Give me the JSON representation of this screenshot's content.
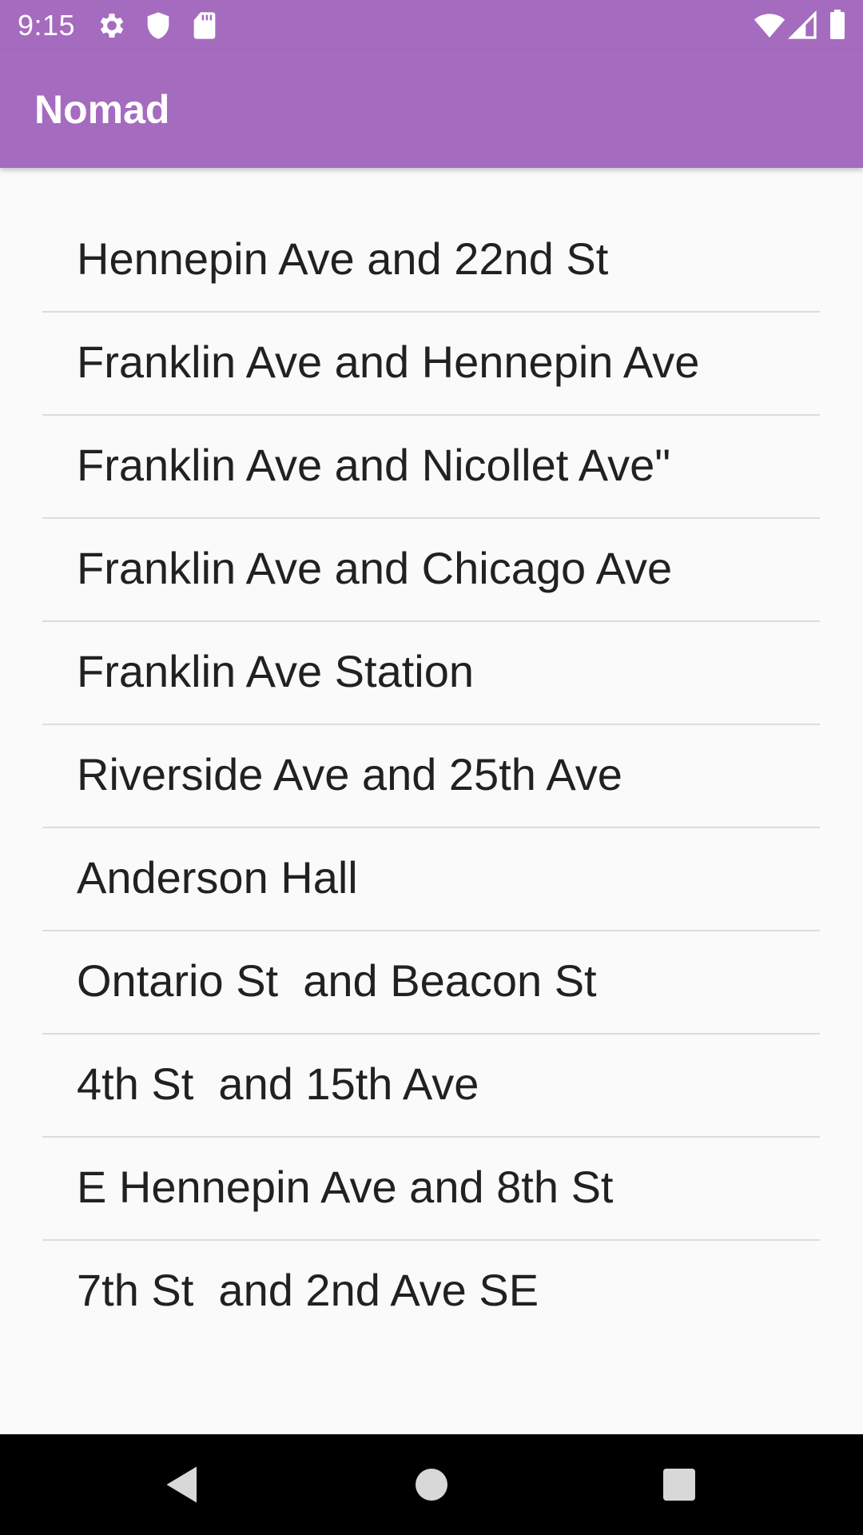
{
  "status_bar": {
    "time": "9:15",
    "icons": [
      "settings-icon",
      "shield-icon",
      "sd-card-icon",
      "wifi-icon",
      "cellular-signal-icon",
      "battery-icon"
    ],
    "background": "#a56bbe"
  },
  "app_bar": {
    "title": "Nomad",
    "background": "#a56bbe"
  },
  "stops": [
    {
      "label": "Hennepin Ave and 22nd St"
    },
    {
      "label": "Franklin Ave and Hennepin Ave"
    },
    {
      "label": "Franklin Ave and Nicollet Ave\""
    },
    {
      "label": "Franklin Ave and Chicago Ave"
    },
    {
      "label": "Franklin Ave Station"
    },
    {
      "label": "Riverside Ave and 25th Ave"
    },
    {
      "label": "Anderson Hall"
    },
    {
      "label": "Ontario St  and Beacon St"
    },
    {
      "label": "4th St  and 15th Ave"
    },
    {
      "label": "E Hennepin Ave and 8th St"
    },
    {
      "label": "7th St  and 2nd Ave SE"
    }
  ],
  "nav_bar": {
    "buttons": [
      "back-icon",
      "home-icon",
      "recents-icon"
    ]
  }
}
